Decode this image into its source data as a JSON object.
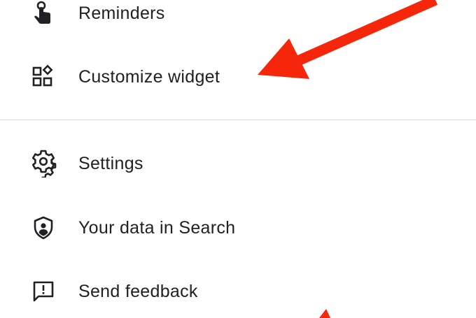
{
  "menu": {
    "items": [
      {
        "id": "reminders",
        "label": "Reminders",
        "icon": "reminder-hand-icon"
      },
      {
        "id": "customize-widget",
        "label": "Customize widget",
        "icon": "widgets-icon"
      },
      {
        "id": "settings",
        "label": "Settings",
        "icon": "gear-icon"
      },
      {
        "id": "your-data",
        "label": "Your data in Search",
        "icon": "shield-person-icon"
      },
      {
        "id": "send-feedback",
        "label": "Send feedback",
        "icon": "feedback-icon"
      }
    ]
  },
  "colors": {
    "text": "#202124",
    "icon": "#202124",
    "divider": "#dadce0",
    "arrow": "#f5260a"
  }
}
